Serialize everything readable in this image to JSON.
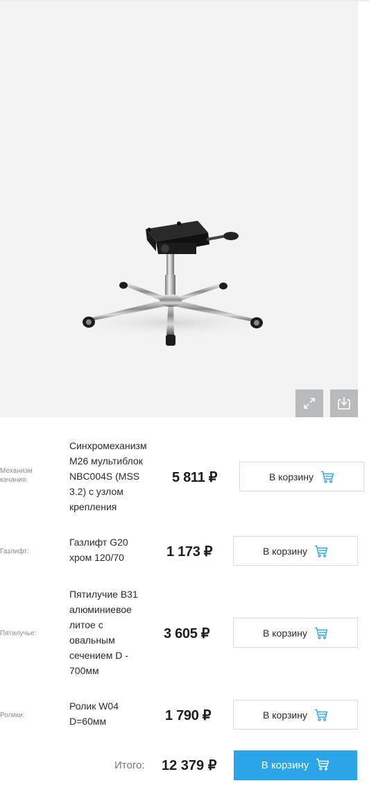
{
  "product_image": {
    "alt": "chair base with mechanism, gas lift, five-star base and casters"
  },
  "toolbar": {
    "expand_icon": "expand-icon",
    "download_icon": "download-icon"
  },
  "components": [
    {
      "label": "Механизм качания:",
      "name": "Синхромеханизм М26 мультиблок NBC004S (MSS 3.2) с узлом крепления",
      "price": "5 811 ₽",
      "button": "В корзину",
      "icon": "cart-icon"
    },
    {
      "label": "Газлифт:",
      "name": "Газлифт G20 хром 120/70",
      "price": "1 173 ₽",
      "button": "В корзину",
      "icon": "cart-icon"
    },
    {
      "label": "Пятилучье:",
      "name": "Пятилучие B31 алюминиевое литое с овальным сечением D - 700мм",
      "price": "3 605 ₽",
      "button": "В корзину",
      "icon": "cart-icon"
    },
    {
      "label": "Ролики:",
      "name": "Ролик W04 D=60мм",
      "price": "1 790 ₽",
      "button": "В корзину",
      "icon": "cart-icon"
    }
  ],
  "total": {
    "label": "Итого:",
    "price": "12 379 ₽",
    "button": "В корзину",
    "icon": "cart-icon"
  },
  "colors": {
    "accent": "#2aa5e8",
    "image_bg": "#f3f3f4",
    "tool_bg": "#b9babb"
  }
}
